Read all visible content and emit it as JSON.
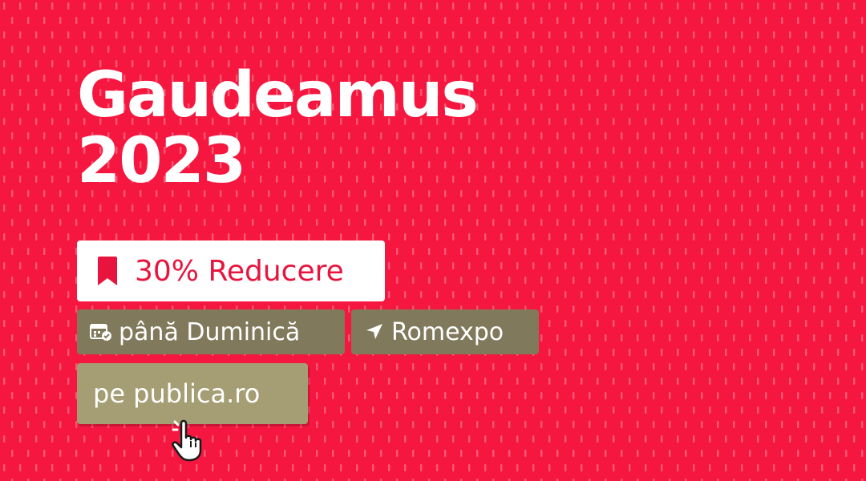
{
  "title": {
    "line1": "Gaudeamus",
    "line2": "2023"
  },
  "discount": {
    "label": "30% Reducere",
    "icon": "bookmark-icon"
  },
  "date_badge": {
    "label": "până Duminică",
    "icon": "calendar-check-icon"
  },
  "location_badge": {
    "label": "Romexpo",
    "icon": "navigation-arrow-icon"
  },
  "cta": {
    "label": "pe publica.ro",
    "icon": "hand-pointer-icon"
  },
  "colors": {
    "background": "#f5173f",
    "accent_text": "#e8143d",
    "badge": "#80795b",
    "cta": "#a59d73"
  }
}
